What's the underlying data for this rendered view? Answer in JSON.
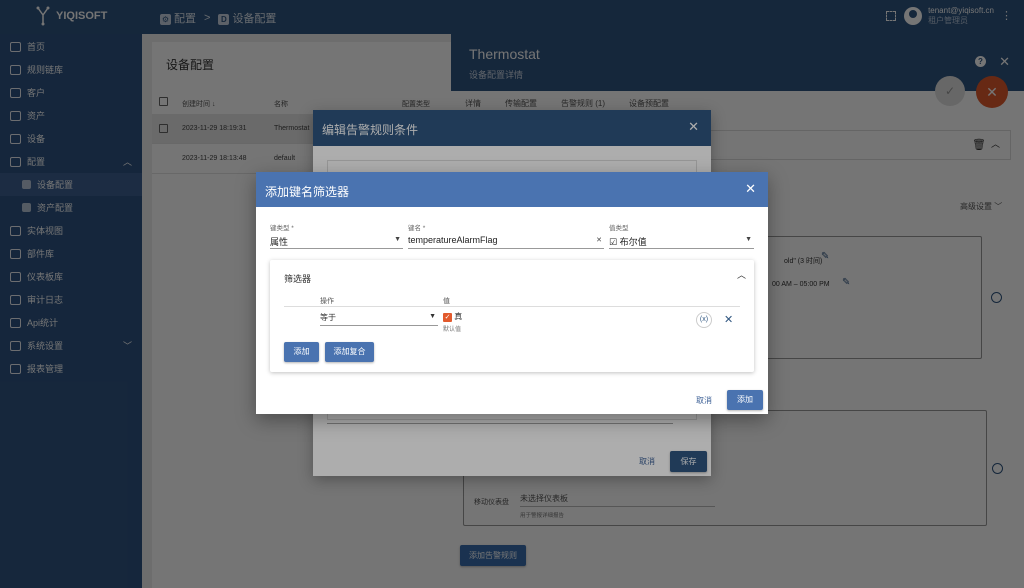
{
  "app": {
    "brand": "YIQISOFT"
  },
  "breadcrumb": {
    "item1": "配置",
    "sep": ">",
    "item2": "设备配置"
  },
  "user": {
    "email": "tenant@yiqisoft.cn",
    "role": "租户管理员"
  },
  "sidebar": {
    "items": [
      {
        "label": "首页"
      },
      {
        "label": "规则链库"
      },
      {
        "label": "客户"
      },
      {
        "label": "资产"
      },
      {
        "label": "设备"
      },
      {
        "label": "配置"
      },
      {
        "label": "设备配置"
      },
      {
        "label": "资产配置"
      },
      {
        "label": "实体视图"
      },
      {
        "label": "部件库"
      },
      {
        "label": "仪表板库"
      },
      {
        "label": "审计日志"
      },
      {
        "label": "Api统计"
      },
      {
        "label": "系统设置"
      },
      {
        "label": "报表管理"
      }
    ]
  },
  "main": {
    "title": "设备配置",
    "columns": {
      "created": "创建时间",
      "name": "名称",
      "type": "配置类型"
    },
    "rows": [
      {
        "created": "2023-11-29 18:19:31",
        "name": "Thermostat"
      },
      {
        "created": "2023-11-29 18:13:48",
        "name": "default"
      }
    ]
  },
  "panel": {
    "title": "Thermostat",
    "subtitle": "设备配置详情",
    "tabs": [
      "详情",
      "传输配置",
      "告警规则 (1)",
      "设备预配置"
    ],
    "advanced": "高级设置",
    "schedule1": "old\" (3 时间)",
    "schedule2": "00 AM – 05:00 PM",
    "mobile_label": "移动仪表盘",
    "mobile_value": "未选择仪表板",
    "mobile_hint": "用于警报详细报告",
    "add_alarm_rule": "添加告警规则"
  },
  "dialog1": {
    "title": "编辑告警规则条件",
    "cancel": "取消",
    "save": "保存"
  },
  "dialog2": {
    "title": "添加键名筛选器",
    "key_type_label": "键类型 *",
    "key_type_value": "属性",
    "key_name_label": "键名 *",
    "key_name_value": "temperatureAlarmFlag",
    "value_type_label": "值类型",
    "value_type_value": "布尔值",
    "filters_title": "筛选器",
    "op_header": "操作",
    "val_header": "值",
    "op_value": "等于",
    "bool_label": "真",
    "default_hint": "默认值",
    "dyn_label": "(x)",
    "add": "添加",
    "add_complex": "添加复合",
    "cancel": "取消",
    "confirm": "添加"
  }
}
